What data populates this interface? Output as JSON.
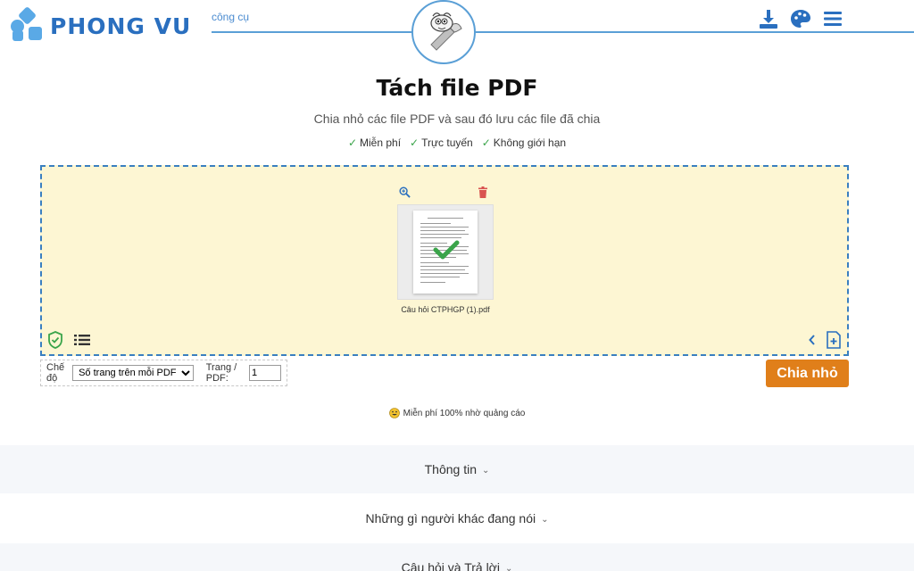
{
  "brand": {
    "name": "PHONG VU"
  },
  "nav": {
    "tools_link": "công cụ"
  },
  "header_icons": [
    "download-icon",
    "palette-icon",
    "menu-icon"
  ],
  "page": {
    "title": "Tách file PDF",
    "subtitle": "Chia nhỏ các file PDF và sau đó lưu các file đã chia",
    "features": [
      {
        "check": "✓",
        "label": "Miễn phí"
      },
      {
        "check": "✓",
        "label": "Trực tuyến"
      },
      {
        "check": "✓",
        "label": "Không giới hạn"
      }
    ]
  },
  "file": {
    "name": "Câu hỏi CTPHGP (1).pdf"
  },
  "options": {
    "mode_label": "Chế độ",
    "mode_selected": "Số trang trên mỗi PDF",
    "pages_label": "Trang / PDF:",
    "pages_value": "1"
  },
  "actions": {
    "split_label": "Chia nhỏ"
  },
  "note": {
    "free_text": "Miễn phí 100% nhờ quảng cáo"
  },
  "accordions": [
    {
      "label": "Thông tin"
    },
    {
      "label": "Những gì người khác đang nói"
    },
    {
      "label": "Câu hỏi và Trả lời"
    }
  ],
  "colors": {
    "accent": "#2a6fbf",
    "dropzone_bg": "#fdf6d3",
    "split_button": "#e07f1a",
    "check": "#3aa44a"
  }
}
